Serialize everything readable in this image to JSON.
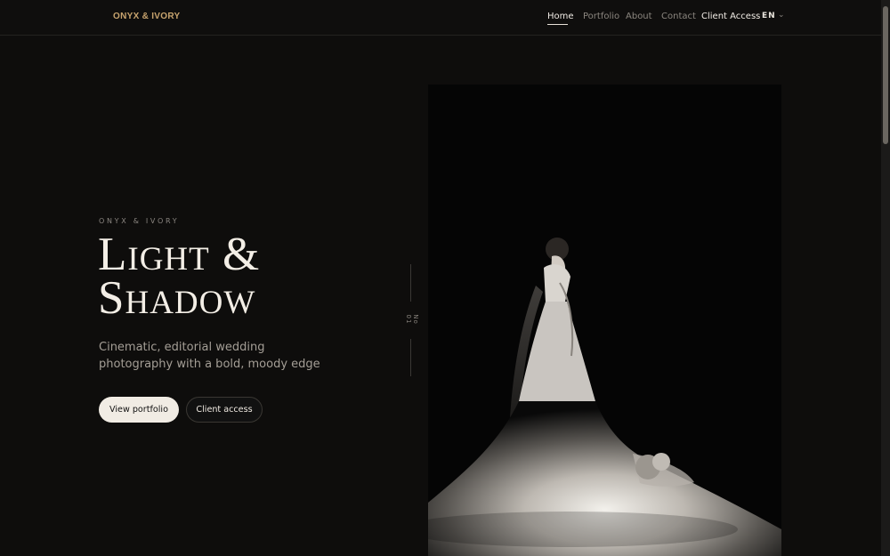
{
  "brand": {
    "logo_text": "ONYX & IVORY",
    "accent": "#C8A46E"
  },
  "nav": {
    "items": [
      {
        "label": "Home",
        "active": true
      },
      {
        "label": "Portfolio",
        "active": false
      },
      {
        "label": "About",
        "active": false
      },
      {
        "label": "Contact",
        "active": false
      },
      {
        "label": "Client Access",
        "active": false
      }
    ],
    "language": "EN",
    "language_icon": "chevron-down-icon"
  },
  "hero": {
    "eyebrow": "ONYX & IVORY",
    "title_line1": "Light &",
    "title_line2": "Shadow",
    "subtitle": "Cinematic, editorial wedding photography with a bold, moody edge",
    "primary_button": "View portfolio",
    "secondary_button": "Client access",
    "side_label": "No 01"
  },
  "colors": {
    "background": "#0E0D0C",
    "text": "#ECE7DF",
    "muted": "#8B867F"
  }
}
